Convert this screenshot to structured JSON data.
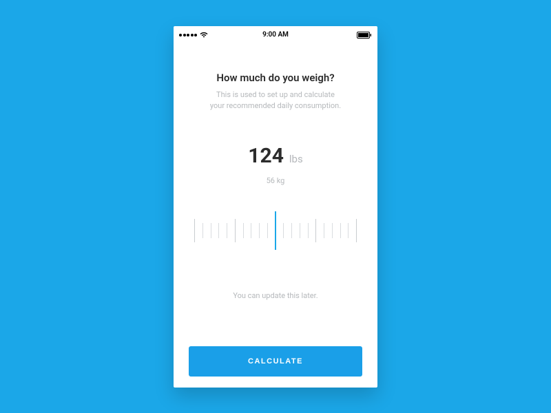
{
  "status_bar": {
    "time": "9:00 AM"
  },
  "heading": "How much do you weigh?",
  "subheading_line1": "This is used to set up and calculate",
  "subheading_line2": "your recommended daily consumption.",
  "weight": {
    "primary_value": "124",
    "primary_unit": "lbs",
    "secondary_value": "56",
    "secondary_unit": "kg"
  },
  "hint": "You can update this later.",
  "calculate_label": "CALCULATE",
  "colors": {
    "accent": "#1ba7e8",
    "bg": "#1ba7e8"
  }
}
